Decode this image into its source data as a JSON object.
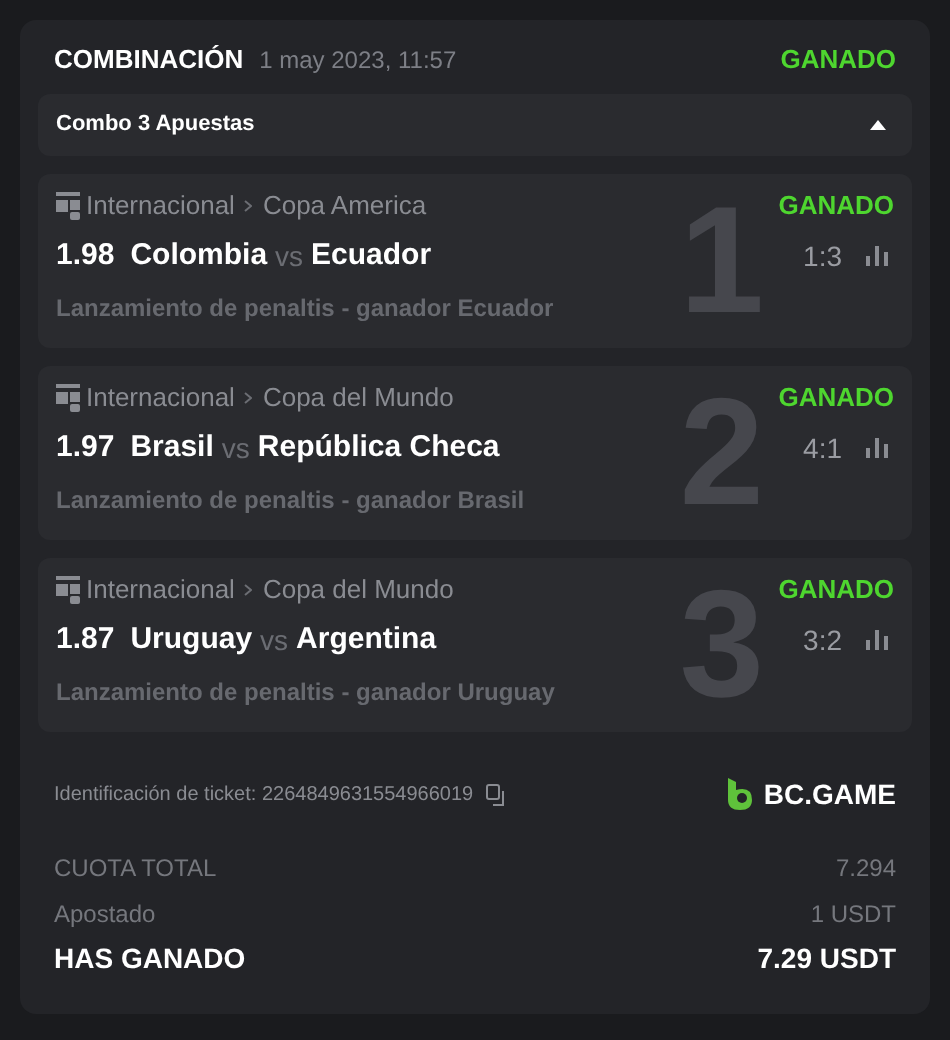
{
  "header": {
    "title": "COMBINACIÓN",
    "date": "1 may 2023, 11:57",
    "status": "GANADO"
  },
  "combo": {
    "label": "Combo 3 Apuestas",
    "expanded": true
  },
  "bets": [
    {
      "number": "1",
      "category": "Internacional",
      "league": "Copa America",
      "status": "GANADO",
      "odds": "1.98",
      "home": "Colombia",
      "vs": "vs",
      "away": "Ecuador",
      "score": "1:3",
      "market": "Lanzamiento de penaltis - ganador Ecuador"
    },
    {
      "number": "2",
      "category": "Internacional",
      "league": "Copa del Mundo",
      "status": "GANADO",
      "odds": "1.97",
      "home": "Brasil",
      "vs": "vs",
      "away": "República Checa",
      "score": "4:1",
      "market": "Lanzamiento de penaltis - ganador Brasil"
    },
    {
      "number": "3",
      "category": "Internacional",
      "league": "Copa del Mundo",
      "status": "GANADO",
      "odds": "1.87",
      "home": "Uruguay",
      "vs": "vs",
      "away": "Argentina",
      "score": "3:2",
      "market": "Lanzamiento de penaltis - ganador Uruguay"
    }
  ],
  "ticket": {
    "label": "Identificación de ticket: 2264849631554966019",
    "brand": "BC.GAME"
  },
  "totals": [
    {
      "kind": "muted",
      "label": "CUOTA TOTAL",
      "value": "7.294"
    },
    {
      "kind": "muted",
      "label": "Apostado",
      "value": "1 USDT"
    },
    {
      "kind": "strong",
      "label": "HAS GANADO",
      "value": "7.29 USDT"
    }
  ]
}
